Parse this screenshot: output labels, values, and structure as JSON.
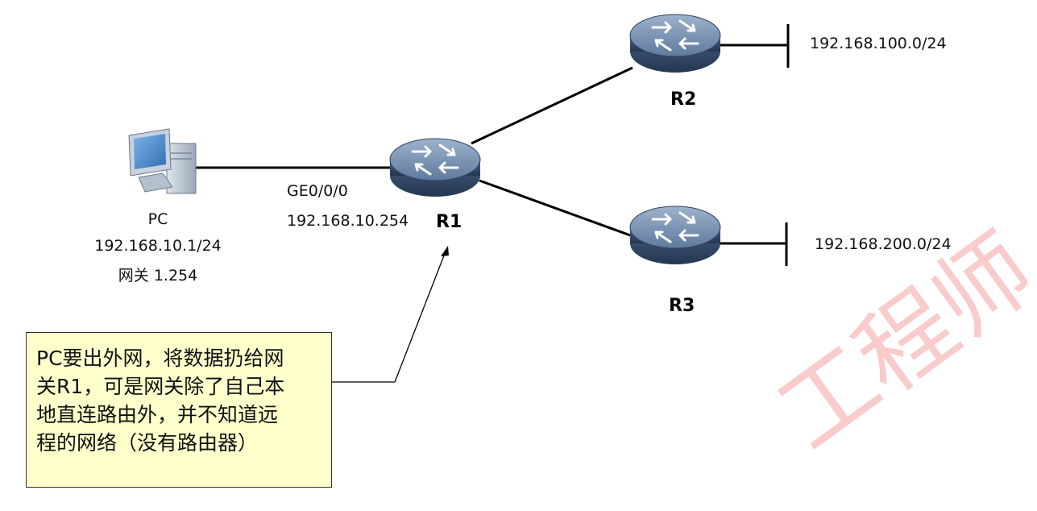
{
  "pc": {
    "name": "PC",
    "ip": "192.168.10.1/24",
    "gateway": "网关 1.254"
  },
  "r1": {
    "name": "R1",
    "interface": "GE0/0/0",
    "interface_ip": "192.168.10.254"
  },
  "r2": {
    "name": "R2",
    "network": "192.168.100.0/24"
  },
  "r3": {
    "name": "R3",
    "network": "192.168.200.0/24"
  },
  "callout": {
    "text": "PC要出外网，将数据扔给网\n关R1，可是网关除了自己本\n地直连路由外，并不知道远\n程的网络（没有路由器）"
  },
  "watermark": {
    "text": "工程师"
  },
  "colors": {
    "router_body": "#3a5273",
    "router_top": "#8198b6",
    "callout_bg": "#ffffcc",
    "watermark": "#e84646"
  }
}
